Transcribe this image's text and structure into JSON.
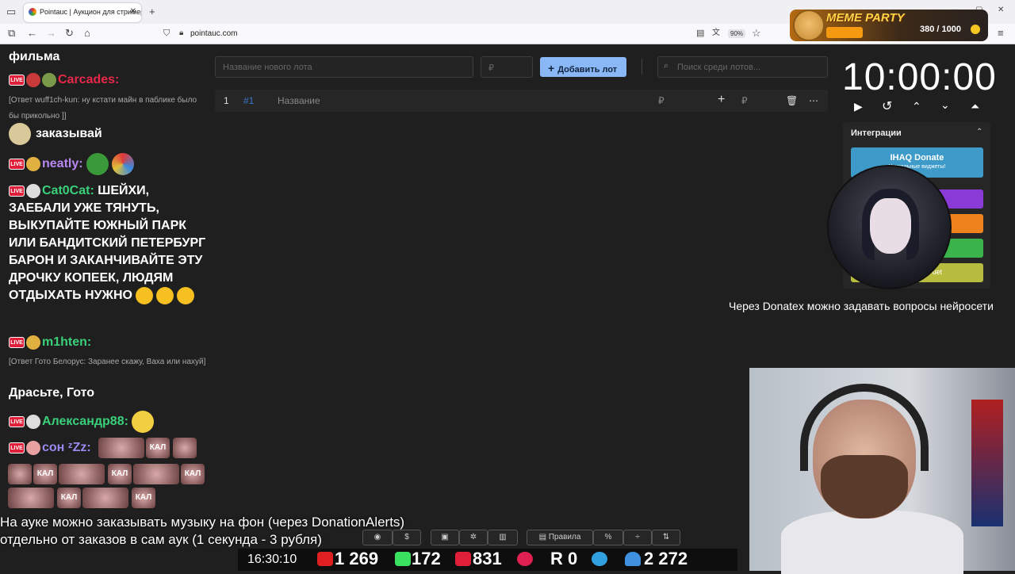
{
  "browser": {
    "tab_title": "Pointauc | Аукцион для стримера",
    "url": "pointauc.com",
    "zoom": "90%"
  },
  "meme_party": {
    "title": "MEME PARTY",
    "counter": "380 / 1000"
  },
  "toolbar": {
    "new_lot_placeholder": "Название нового лота",
    "amount_placeholder": "₽",
    "add_lot_label": "Добавить лот",
    "search_placeholder": "Поиск среди лотов..."
  },
  "lots": [
    {
      "index": "1",
      "id": "#1",
      "name": "Название",
      "currency": "₽",
      "amount_currency": "₽"
    }
  ],
  "timer": {
    "value": "10:00:00"
  },
  "integrations": {
    "title": "Интеграции",
    "items": [
      {
        "label": "IHAQ Donate",
        "sub": "Уникальные виджеты!",
        "color": "#3e9bc9"
      },
      {
        "label": "",
        "color": "#8a3ad6"
      },
      {
        "label": "",
        "color": "#f0821e"
      },
      {
        "label": "",
        "color": "#3ab44a"
      },
      {
        "label": "uet",
        "color": "#b8bc3e"
      }
    ]
  },
  "chat": {
    "messages": [
      {
        "text": "фильма"
      },
      {
        "user": "Carcades:",
        "color": "#e8284a"
      },
      {
        "reply": "[Ответ wuff1ch-kun: ну кстати майн в паблике было бы прикольно ]]"
      },
      {
        "text": "заказывай"
      },
      {
        "user": "neatly:",
        "color": "#b888f0"
      },
      {
        "user": "Cat0Cat:",
        "color": "#3ad07a",
        "text": "ШЕЙХИ, ЗАЕБАЛИ УЖЕ ТЯНУТЬ, ВЫКУПАЙТЕ ЮЖНЫЙ ПАРК ИЛИ БАНДИТСКИЙ ПЕТЕРБУРГ БАРОН И ЗАКАНЧИВАЙТЕ ЭТУ ДРОЧКУ КОПЕЕК, ЛЮДЯМ ОТДЫХАТЬ НУЖНО"
      },
      {
        "user": "m1hten:",
        "color": "#3ad07a"
      },
      {
        "reply": "[Ответ Гото Белорус: Заранее скажу, Ваха или нахуй]"
      },
      {
        "text": "Драсьте, Гото"
      },
      {
        "user": "Александр88:",
        "color": "#3ad07a"
      },
      {
        "user": "сон ᶻZz:",
        "color": "#9a8af0"
      }
    ],
    "emote_text": "КАЛ"
  },
  "ticker": "Через Donatex можно задавать вопросы нейросети",
  "caption": {
    "line1": "На ауке можно заказывать музыку на фон (через DonationAlerts)",
    "line2": "отдельно от заказов в сам аук (1 секунда - 3 рубля)"
  },
  "bottom_toolbar": {
    "rules_label": "Правила"
  },
  "stats": {
    "clock": "16:30:10",
    "youtube": "1 269",
    "kick": "172",
    "vk": "831",
    "rutube": "",
    "r": "0",
    "telegram": "",
    "viewers": "2 272"
  }
}
